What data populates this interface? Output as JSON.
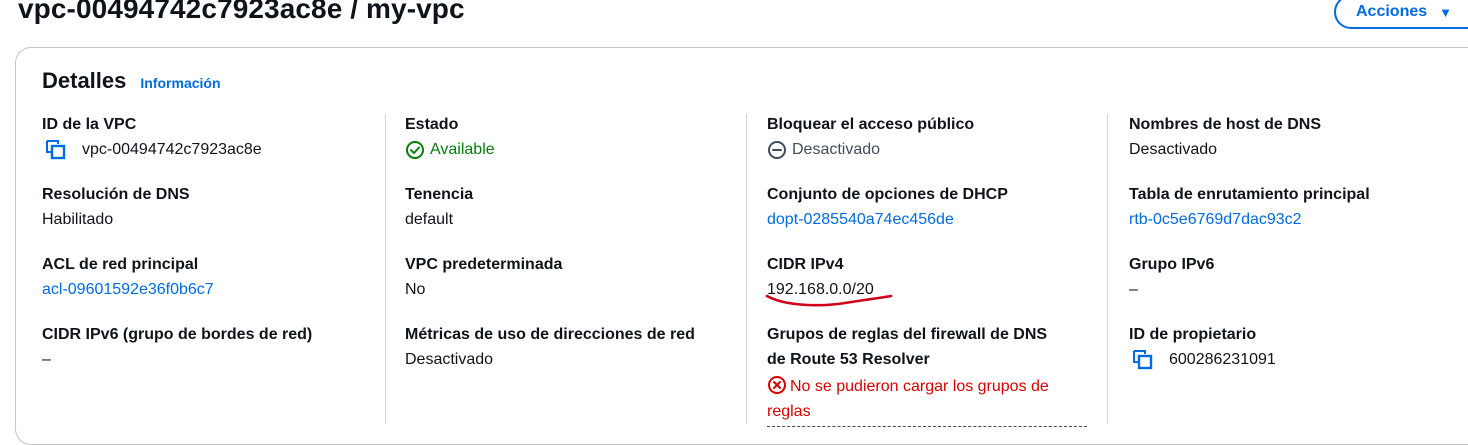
{
  "header": {
    "title": "vpc-00494742c7923ac8e / my-vpc",
    "actions_label": "Acciones",
    "actions_caret": "▼"
  },
  "details": {
    "title": "Detalles",
    "info_link": "Información"
  },
  "columns": [
    [
      {
        "label": "ID de la VPC",
        "value": "vpc-00494742c7923ac8e",
        "icon": "copy-icon"
      },
      {
        "label": "Resolución de DNS",
        "value": "Habilitado"
      },
      {
        "label": "ACL de red principal",
        "value": "acl-09601592e36f0b6c7"
      },
      {
        "label": "CIDR IPv6 (grupo de bordes de red)",
        "value": "–"
      }
    ],
    [
      {
        "label": "Estado",
        "value": "Available",
        "icon": "check-circle-icon"
      },
      {
        "label": "Tenencia",
        "value": "default"
      },
      {
        "label": "VPC predeterminada",
        "value": "No"
      },
      {
        "label": "Métricas de uso de direcciones de red",
        "value": "Desactivado"
      }
    ],
    [
      {
        "label": "Bloquear el acceso público",
        "value": "Desactivado",
        "icon": "minus-circle-icon"
      },
      {
        "label": "Conjunto de opciones de DHCP",
        "value": "dopt-0285540a74ec456de"
      },
      {
        "label": "CIDR IPv4",
        "value": "192.168.0.0/20"
      },
      {
        "label_line1": "Grupos de reglas del firewall de DNS",
        "label_line2": "de Route 53 Resolver",
        "value": "No se pudieron cargar los grupos de reglas",
        "icon": "error-circle-icon"
      }
    ],
    [
      {
        "label": "Nombres de host de DNS",
        "value": "Desactivado"
      },
      {
        "label": "Tabla de enrutamiento principal",
        "value": "rtb-0c5e6769d7dac93c2"
      },
      {
        "label": "Grupo IPv6",
        "value": "–"
      },
      {
        "label": "ID de propietario",
        "value": "600286231091",
        "icon": "copy-icon"
      }
    ]
  ],
  "colors": {
    "link": "#006ce0",
    "success": "#037f0c",
    "error": "#db0000",
    "annotation": "#d0021b"
  }
}
